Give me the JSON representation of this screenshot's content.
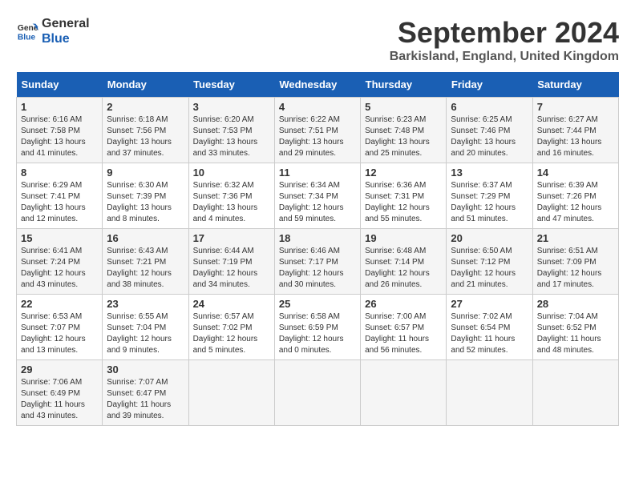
{
  "logo": {
    "line1": "General",
    "line2": "Blue"
  },
  "title": "September 2024",
  "subtitle": "Barkisland, England, United Kingdom",
  "days_header": [
    "Sunday",
    "Monday",
    "Tuesday",
    "Wednesday",
    "Thursday",
    "Friday",
    "Saturday"
  ],
  "weeks": [
    [
      {
        "day": "1",
        "lines": [
          "Sunrise: 6:16 AM",
          "Sunset: 7:58 PM",
          "Daylight: 13 hours",
          "and 41 minutes."
        ]
      },
      {
        "day": "2",
        "lines": [
          "Sunrise: 6:18 AM",
          "Sunset: 7:56 PM",
          "Daylight: 13 hours",
          "and 37 minutes."
        ]
      },
      {
        "day": "3",
        "lines": [
          "Sunrise: 6:20 AM",
          "Sunset: 7:53 PM",
          "Daylight: 13 hours",
          "and 33 minutes."
        ]
      },
      {
        "day": "4",
        "lines": [
          "Sunrise: 6:22 AM",
          "Sunset: 7:51 PM",
          "Daylight: 13 hours",
          "and 29 minutes."
        ]
      },
      {
        "day": "5",
        "lines": [
          "Sunrise: 6:23 AM",
          "Sunset: 7:48 PM",
          "Daylight: 13 hours",
          "and 25 minutes."
        ]
      },
      {
        "day": "6",
        "lines": [
          "Sunrise: 6:25 AM",
          "Sunset: 7:46 PM",
          "Daylight: 13 hours",
          "and 20 minutes."
        ]
      },
      {
        "day": "7",
        "lines": [
          "Sunrise: 6:27 AM",
          "Sunset: 7:44 PM",
          "Daylight: 13 hours",
          "and 16 minutes."
        ]
      }
    ],
    [
      {
        "day": "8",
        "lines": [
          "Sunrise: 6:29 AM",
          "Sunset: 7:41 PM",
          "Daylight: 13 hours",
          "and 12 minutes."
        ]
      },
      {
        "day": "9",
        "lines": [
          "Sunrise: 6:30 AM",
          "Sunset: 7:39 PM",
          "Daylight: 13 hours",
          "and 8 minutes."
        ]
      },
      {
        "day": "10",
        "lines": [
          "Sunrise: 6:32 AM",
          "Sunset: 7:36 PM",
          "Daylight: 13 hours",
          "and 4 minutes."
        ]
      },
      {
        "day": "11",
        "lines": [
          "Sunrise: 6:34 AM",
          "Sunset: 7:34 PM",
          "Daylight: 12 hours",
          "and 59 minutes."
        ]
      },
      {
        "day": "12",
        "lines": [
          "Sunrise: 6:36 AM",
          "Sunset: 7:31 PM",
          "Daylight: 12 hours",
          "and 55 minutes."
        ]
      },
      {
        "day": "13",
        "lines": [
          "Sunrise: 6:37 AM",
          "Sunset: 7:29 PM",
          "Daylight: 12 hours",
          "and 51 minutes."
        ]
      },
      {
        "day": "14",
        "lines": [
          "Sunrise: 6:39 AM",
          "Sunset: 7:26 PM",
          "Daylight: 12 hours",
          "and 47 minutes."
        ]
      }
    ],
    [
      {
        "day": "15",
        "lines": [
          "Sunrise: 6:41 AM",
          "Sunset: 7:24 PM",
          "Daylight: 12 hours",
          "and 43 minutes."
        ]
      },
      {
        "day": "16",
        "lines": [
          "Sunrise: 6:43 AM",
          "Sunset: 7:21 PM",
          "Daylight: 12 hours",
          "and 38 minutes."
        ]
      },
      {
        "day": "17",
        "lines": [
          "Sunrise: 6:44 AM",
          "Sunset: 7:19 PM",
          "Daylight: 12 hours",
          "and 34 minutes."
        ]
      },
      {
        "day": "18",
        "lines": [
          "Sunrise: 6:46 AM",
          "Sunset: 7:17 PM",
          "Daylight: 12 hours",
          "and 30 minutes."
        ]
      },
      {
        "day": "19",
        "lines": [
          "Sunrise: 6:48 AM",
          "Sunset: 7:14 PM",
          "Daylight: 12 hours",
          "and 26 minutes."
        ]
      },
      {
        "day": "20",
        "lines": [
          "Sunrise: 6:50 AM",
          "Sunset: 7:12 PM",
          "Daylight: 12 hours",
          "and 21 minutes."
        ]
      },
      {
        "day": "21",
        "lines": [
          "Sunrise: 6:51 AM",
          "Sunset: 7:09 PM",
          "Daylight: 12 hours",
          "and 17 minutes."
        ]
      }
    ],
    [
      {
        "day": "22",
        "lines": [
          "Sunrise: 6:53 AM",
          "Sunset: 7:07 PM",
          "Daylight: 12 hours",
          "and 13 minutes."
        ]
      },
      {
        "day": "23",
        "lines": [
          "Sunrise: 6:55 AM",
          "Sunset: 7:04 PM",
          "Daylight: 12 hours",
          "and 9 minutes."
        ]
      },
      {
        "day": "24",
        "lines": [
          "Sunrise: 6:57 AM",
          "Sunset: 7:02 PM",
          "Daylight: 12 hours",
          "and 5 minutes."
        ]
      },
      {
        "day": "25",
        "lines": [
          "Sunrise: 6:58 AM",
          "Sunset: 6:59 PM",
          "Daylight: 12 hours",
          "and 0 minutes."
        ]
      },
      {
        "day": "26",
        "lines": [
          "Sunrise: 7:00 AM",
          "Sunset: 6:57 PM",
          "Daylight: 11 hours",
          "and 56 minutes."
        ]
      },
      {
        "day": "27",
        "lines": [
          "Sunrise: 7:02 AM",
          "Sunset: 6:54 PM",
          "Daylight: 11 hours",
          "and 52 minutes."
        ]
      },
      {
        "day": "28",
        "lines": [
          "Sunrise: 7:04 AM",
          "Sunset: 6:52 PM",
          "Daylight: 11 hours",
          "and 48 minutes."
        ]
      }
    ],
    [
      {
        "day": "29",
        "lines": [
          "Sunrise: 7:06 AM",
          "Sunset: 6:49 PM",
          "Daylight: 11 hours",
          "and 43 minutes."
        ]
      },
      {
        "day": "30",
        "lines": [
          "Sunrise: 7:07 AM",
          "Sunset: 6:47 PM",
          "Daylight: 11 hours",
          "and 39 minutes."
        ]
      },
      null,
      null,
      null,
      null,
      null
    ]
  ]
}
